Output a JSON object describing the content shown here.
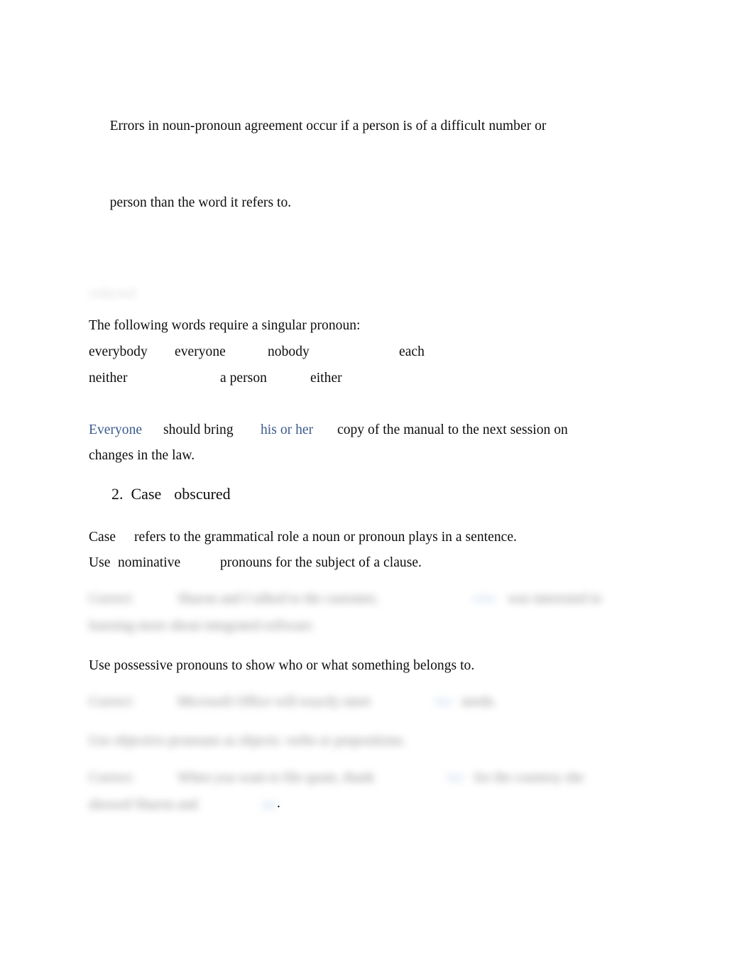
{
  "document": {
    "page_background": "#ffffff",
    "text_color": "#0d0d0d",
    "accent_color": "#3a5a8c",
    "blurred_text_color": "#8fb4e3"
  },
  "blocks": {
    "intro": {
      "line1": "Errors in noun-pronoun agreement occur if a person is of a difficult number or",
      "line2": "person than the word it refers to."
    },
    "redacted_top": {
      "text": "redacted"
    },
    "singular_intro": "The following words require a singular pronoun:",
    "word_list": {
      "row1": {
        "w1": "everybody",
        "w2": "everyone",
        "w3": "nobody",
        "w4": "each"
      },
      "row2": {
        "w1": "neither",
        "w2": "a person",
        "w3": "either"
      }
    },
    "example_everyone": {
      "part1": "Everyone",
      "part2": "should bring",
      "part3": "his or her",
      "part4": "copy of the manual to the next session on",
      "part5": "changes in the law."
    },
    "heading_case": {
      "number": "2.",
      "title": "Case",
      "blurred_suffix": "obscured"
    },
    "case_definition": {
      "line1_a": "Case",
      "line1_b": "refers to the grammatical role a noun or pronoun plays in a sentence.",
      "line2_a": "Use",
      "line2_b": "nominative",
      "line2_c": "pronouns for the subject of a clause."
    },
    "correct_nominative": {
      "label": "Correct:",
      "text_a": "Sharon and I talked to the customer,",
      "highlight": "who",
      "text_b": "was interested in",
      "line2": "learning more about integrated software."
    },
    "possessive_intro": "Use possessive pronouns to show who or what something belongs to.",
    "correct_possessive": {
      "label": "Correct:",
      "text_a": "Microsoft Office will exactly meet",
      "highlight": "her",
      "text_b": "needs."
    },
    "objective_intro": "Use objective pronouns as objects: verbs or prepositions.",
    "correct_objective": {
      "label": "Correct:",
      "text_a": "When you want to file quote, thank",
      "highlight": "her",
      "text_b": "for the courtesy she",
      "line2_a": "showed Sharon and",
      "line2_highlight": "me",
      "line2_period": "."
    }
  }
}
